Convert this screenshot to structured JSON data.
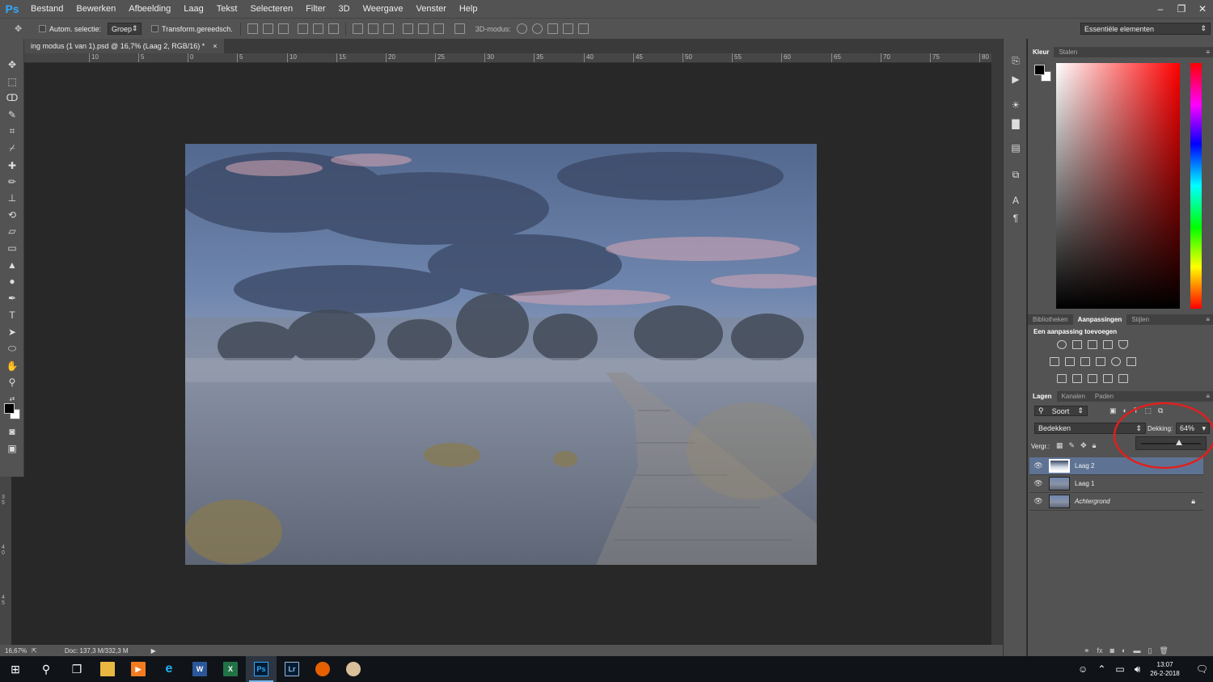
{
  "app": {
    "logo": "Ps"
  },
  "menubar": {
    "items": [
      "Bestand",
      "Bewerken",
      "Afbeelding",
      "Laag",
      "Tekst",
      "Selecteren",
      "Filter",
      "3D",
      "Weergave",
      "Venster",
      "Help"
    ]
  },
  "window_controls": {
    "minimize": "–",
    "restore": "❐",
    "close": "✕"
  },
  "options": {
    "auto_select_label": "Autom. selectie:",
    "auto_select_value": "Groep",
    "transform_label": "Transform.gereedsch.",
    "mode3d_label": "3D-modus:",
    "workspace": "Essentiële elementen"
  },
  "document": {
    "tab_title": "ing modus (1 van 1).psd @ 16,7% (Laag 2, RGB/16) *",
    "close_glyph": "×"
  },
  "ruler": {
    "labels": [
      "10",
      "5",
      "0",
      "5",
      "10",
      "15",
      "20",
      "25",
      "30",
      "35",
      "40",
      "45",
      "50",
      "55",
      "60",
      "65",
      "70",
      "75",
      "80"
    ]
  },
  "vruler": {
    "labels": [
      "3 5",
      "4 0",
      "4 5"
    ]
  },
  "status": {
    "zoom": "16,67%",
    "doc": "Doc: 137,3 M/332,3 M"
  },
  "color_panel": {
    "tabs": [
      "Kleur",
      "Stalen"
    ],
    "fg": "#000000",
    "bg": "#ffffff"
  },
  "adjust_panel": {
    "tabs": [
      "Bibliotheken",
      "Aanpassingen",
      "Stijlen"
    ],
    "title": "Een aanpassing toevoegen"
  },
  "layers_panel": {
    "tabs": [
      "Lagen",
      "Kanalen",
      "Paden"
    ],
    "filter": "Soort",
    "blend_mode": "Bedekken",
    "opacity_label": "Dekking:",
    "opacity_value": "64%",
    "opacity": 0.64,
    "lock_label": "Vergr.:",
    "layers": [
      {
        "name": "Laag 2",
        "active": true,
        "italic": false,
        "locked": false
      },
      {
        "name": "Laag 1",
        "active": false,
        "italic": false,
        "locked": false
      },
      {
        "name": "Achtergrond",
        "active": false,
        "italic": true,
        "locked": true
      }
    ]
  },
  "taskbar": {
    "time": "13:07",
    "date": "26-2-2018",
    "apps": [
      "start-icon",
      "search-icon",
      "task-view-icon",
      "explorer-icon",
      "media-icon",
      "ie-icon",
      "word-icon",
      "excel-icon",
      "photoshop-icon",
      "lightroom-icon",
      "firefox-icon",
      "paint-icon"
    ]
  },
  "colors": {
    "annotation": "#e0201e",
    "accent": "#31a8ff"
  }
}
